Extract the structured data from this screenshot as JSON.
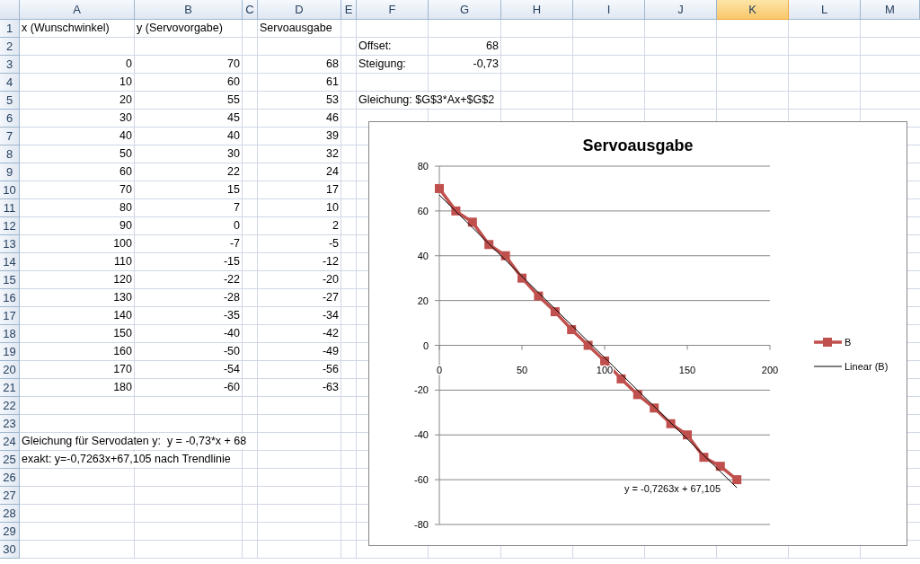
{
  "columns": [
    {
      "letter": "A",
      "selected": false
    },
    {
      "letter": "B",
      "selected": false
    },
    {
      "letter": "C",
      "selected": false
    },
    {
      "letter": "D",
      "selected": false
    },
    {
      "letter": "E",
      "selected": false
    },
    {
      "letter": "F",
      "selected": false
    },
    {
      "letter": "G",
      "selected": false
    },
    {
      "letter": "H",
      "selected": false
    },
    {
      "letter": "I",
      "selected": false
    },
    {
      "letter": "J",
      "selected": false
    },
    {
      "letter": "K",
      "selected": true
    },
    {
      "letter": "L",
      "selected": false
    },
    {
      "letter": "M",
      "selected": false
    }
  ],
  "rows": [
    {
      "number": "1",
      "cells": {
        "A": {
          "text": "x (Wunschwinkel)",
          "kind": "text"
        },
        "B": {
          "text": "y (Servovorgabe)",
          "kind": "text"
        },
        "D": {
          "text": "Servoausgabe",
          "kind": "text"
        }
      }
    },
    {
      "number": "2",
      "cells": {
        "F": {
          "text": "Offset:",
          "kind": "text"
        },
        "G": {
          "text": "68",
          "kind": "number"
        }
      }
    },
    {
      "number": "3",
      "cells": {
        "A": {
          "text": "0",
          "kind": "number"
        },
        "B": {
          "text": "70",
          "kind": "number"
        },
        "D": {
          "text": "68",
          "kind": "number"
        },
        "F": {
          "text": "Steigung:",
          "kind": "text"
        },
        "G": {
          "text": "-0,73",
          "kind": "number"
        }
      }
    },
    {
      "number": "4",
      "cells": {
        "A": {
          "text": "10",
          "kind": "number"
        },
        "B": {
          "text": "60",
          "kind": "number"
        },
        "D": {
          "text": "61",
          "kind": "number"
        }
      }
    },
    {
      "number": "5",
      "cells": {
        "A": {
          "text": "20",
          "kind": "number"
        },
        "B": {
          "text": "55",
          "kind": "number"
        },
        "D": {
          "text": "53",
          "kind": "number"
        },
        "F": {
          "text": "Gleichung: $G$3*Ax+$G$2",
          "kind": "text"
        }
      }
    },
    {
      "number": "6",
      "cells": {
        "A": {
          "text": "30",
          "kind": "number"
        },
        "B": {
          "text": "45",
          "kind": "number"
        },
        "D": {
          "text": "46",
          "kind": "number"
        }
      }
    },
    {
      "number": "7",
      "cells": {
        "A": {
          "text": "40",
          "kind": "number"
        },
        "B": {
          "text": "40",
          "kind": "number"
        },
        "D": {
          "text": "39",
          "kind": "number"
        }
      }
    },
    {
      "number": "8",
      "cells": {
        "A": {
          "text": "50",
          "kind": "number"
        },
        "B": {
          "text": "30",
          "kind": "number"
        },
        "D": {
          "text": "32",
          "kind": "number"
        }
      }
    },
    {
      "number": "9",
      "cells": {
        "A": {
          "text": "60",
          "kind": "number"
        },
        "B": {
          "text": "22",
          "kind": "number"
        },
        "D": {
          "text": "24",
          "kind": "number"
        }
      }
    },
    {
      "number": "10",
      "cells": {
        "A": {
          "text": "70",
          "kind": "number"
        },
        "B": {
          "text": "15",
          "kind": "number"
        },
        "D": {
          "text": "17",
          "kind": "number"
        }
      }
    },
    {
      "number": "11",
      "cells": {
        "A": {
          "text": "80",
          "kind": "number"
        },
        "B": {
          "text": "7",
          "kind": "number"
        },
        "D": {
          "text": "10",
          "kind": "number"
        }
      }
    },
    {
      "number": "12",
      "cells": {
        "A": {
          "text": "90",
          "kind": "number"
        },
        "B": {
          "text": "0",
          "kind": "number"
        },
        "D": {
          "text": "2",
          "kind": "number"
        }
      }
    },
    {
      "number": "13",
      "cells": {
        "A": {
          "text": "100",
          "kind": "number"
        },
        "B": {
          "text": "-7",
          "kind": "number"
        },
        "D": {
          "text": "-5",
          "kind": "number"
        }
      }
    },
    {
      "number": "14",
      "cells": {
        "A": {
          "text": "110",
          "kind": "number"
        },
        "B": {
          "text": "-15",
          "kind": "number"
        },
        "D": {
          "text": "-12",
          "kind": "number"
        }
      }
    },
    {
      "number": "15",
      "cells": {
        "A": {
          "text": "120",
          "kind": "number"
        },
        "B": {
          "text": "-22",
          "kind": "number"
        },
        "D": {
          "text": "-20",
          "kind": "number"
        }
      }
    },
    {
      "number": "16",
      "cells": {
        "A": {
          "text": "130",
          "kind": "number"
        },
        "B": {
          "text": "-28",
          "kind": "number"
        },
        "D": {
          "text": "-27",
          "kind": "number"
        }
      }
    },
    {
      "number": "17",
      "cells": {
        "A": {
          "text": "140",
          "kind": "number"
        },
        "B": {
          "text": "-35",
          "kind": "number"
        },
        "D": {
          "text": "-34",
          "kind": "number"
        }
      }
    },
    {
      "number": "18",
      "cells": {
        "A": {
          "text": "150",
          "kind": "number"
        },
        "B": {
          "text": "-40",
          "kind": "number"
        },
        "D": {
          "text": "-42",
          "kind": "number"
        }
      }
    },
    {
      "number": "19",
      "cells": {
        "A": {
          "text": "160",
          "kind": "number"
        },
        "B": {
          "text": "-50",
          "kind": "number"
        },
        "D": {
          "text": "-49",
          "kind": "number"
        }
      }
    },
    {
      "number": "20",
      "cells": {
        "A": {
          "text": "170",
          "kind": "number"
        },
        "B": {
          "text": "-54",
          "kind": "number"
        },
        "D": {
          "text": "-56",
          "kind": "number"
        }
      }
    },
    {
      "number": "21",
      "cells": {
        "A": {
          "text": "180",
          "kind": "number"
        },
        "B": {
          "text": "-60",
          "kind": "number"
        },
        "D": {
          "text": "-63",
          "kind": "number"
        }
      }
    },
    {
      "number": "22"
    },
    {
      "number": "23"
    },
    {
      "number": "24",
      "cells": {
        "A": {
          "text": "Gleichung für Servodaten y:  y = -0,73*x + 68",
          "kind": "text"
        }
      }
    },
    {
      "number": "25",
      "cells": {
        "A": {
          "text": "exakt: y=-0,7263x+67,105 nach Trendlinie",
          "kind": "text"
        }
      }
    },
    {
      "number": "26"
    },
    {
      "number": "27"
    },
    {
      "number": "28"
    },
    {
      "number": "29"
    },
    {
      "number": "30"
    }
  ],
  "chart": {
    "chart_data": {
      "type": "line",
      "title": "Servoausgabe",
      "grid": true,
      "x": [
        0,
        10,
        20,
        30,
        40,
        50,
        60,
        70,
        80,
        90,
        100,
        110,
        120,
        130,
        140,
        150,
        160,
        170,
        180
      ],
      "series": [
        {
          "name": "B",
          "color": "#c0504d",
          "marker": "square",
          "values": [
            70,
            60,
            55,
            45,
            40,
            30,
            22,
            15,
            7,
            0,
            -7,
            -15,
            -22,
            -28,
            -35,
            -40,
            -50,
            -54,
            -60
          ]
        },
        {
          "name": "Linear (B)",
          "color": "#000000",
          "marker": "none",
          "values": [
            67.1,
            59.8,
            52.6,
            45.3,
            38.1,
            30.8,
            23.5,
            16.3,
            9,
            1.7,
            -5.5,
            -12.8,
            -20.1,
            -27.3,
            -34.6,
            -41.8,
            -49.1,
            -56.4,
            -63.6
          ]
        }
      ],
      "legend": true,
      "xlim": [
        0,
        200
      ],
      "ylim": [
        -80,
        80
      ],
      "xticks": [
        {
          "value": 0,
          "label": "0"
        },
        {
          "value": 50,
          "label": "50"
        },
        {
          "value": 100,
          "label": "100"
        },
        {
          "value": 150,
          "label": "150"
        },
        {
          "value": 200,
          "label": "200"
        }
      ],
      "yticks": [
        {
          "value": 80,
          "label": "80"
        },
        {
          "value": 60,
          "label": "60"
        },
        {
          "value": 40,
          "label": "40"
        },
        {
          "value": 20,
          "label": "20"
        },
        {
          "value": 0,
          "label": "0"
        },
        {
          "value": -20,
          "label": "-20"
        },
        {
          "value": -40,
          "label": "-40"
        },
        {
          "value": -60,
          "label": "-60"
        },
        {
          "value": -80,
          "label": "-80"
        }
      ],
      "annotations": [
        {
          "text": "y = -0,7263x + 67,105"
        }
      ]
    }
  }
}
